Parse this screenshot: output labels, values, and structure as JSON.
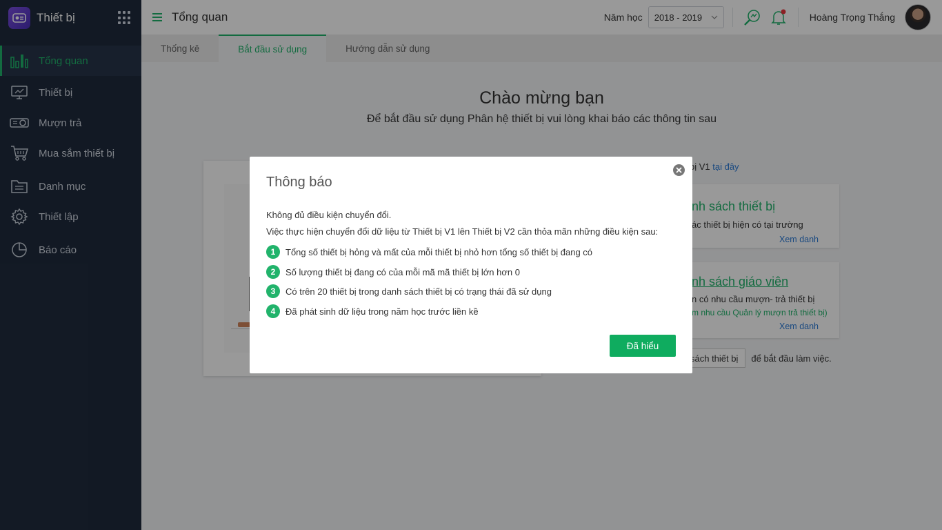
{
  "app": {
    "title": "Thiết bị"
  },
  "sidebar": {
    "items": [
      {
        "label": "Tổng quan",
        "icon": "bar-chart-icon",
        "active": true
      },
      {
        "label": "Thiết bị",
        "icon": "monitor-icon"
      },
      {
        "label": "Mượn trả",
        "icon": "projector-icon"
      },
      {
        "label": "Mua sắm thiết bị",
        "icon": "cart-icon"
      },
      {
        "label": "Danh mục",
        "icon": "folder-list-icon"
      },
      {
        "label": "Thiết lập",
        "icon": "gear-icon"
      },
      {
        "label": "Báo cáo",
        "icon": "pie-chart-icon"
      }
    ]
  },
  "header": {
    "title": "Tổng quan",
    "year_label": "Năm học",
    "year_value": "2018 - 2019",
    "user_name": "Hoàng Trọng  Thắng"
  },
  "tabs": [
    {
      "label": "Thống kê"
    },
    {
      "label": "Bắt đầu sử dụng",
      "active": true
    },
    {
      "label": "Hướng dẫn sử dụng"
    }
  ],
  "main": {
    "welcome_title": "Chào mừng bạn",
    "welcome_subtitle": "Để bắt đầu sử dụng Phân hệ thiết bị vui lòng khai báo các thông tin sau",
    "v1_note": "bị V1 ",
    "v1_link": "tại đây",
    "card1": {
      "title": "nh sách thiết bị",
      "desc": "ác thiết bị hiện có tại trường",
      "link": "Xem danh"
    },
    "card2": {
      "title": "nh sách giáo viên",
      "desc": "n có nhu cầu mượn- trả thiết bị",
      "note": "m nhu cầu Quản lý mượn trả thiết bị)",
      "link": "Xem danh"
    },
    "bottom_button": "sách thiết bị",
    "bottom_text": "để bắt đầu làm việc."
  },
  "modal": {
    "title": "Thông báo",
    "line1": "Không đủ điều kiện chuyển đổi.",
    "line2": "Việc thực hiện chuyển đổi dữ liệu từ Thiết bị V1 lên Thiết bị V2 cần thỏa mãn những điều kiện sau:",
    "conditions": [
      {
        "num": "1",
        "text": "Tổng số thiết bị hỏng và mất của mỗi thiết bị nhỏ hơn tổng số thiết bị đang có"
      },
      {
        "num": "2",
        "text": "Số lượng thiết bị đang có của mỗi mã mã thiết bị lớn hơn 0"
      },
      {
        "num": "3",
        "text": "Có trên 20 thiết bị trong danh sách thiết bị có trạng thái đã sử dụng"
      },
      {
        "num": "4",
        "text": "Đã phát sinh dữ liệu trong năm học trước liền kề"
      }
    ],
    "ok_button": "Đã hiểu"
  },
  "colors": {
    "accent": "#21b36b",
    "sidebar_bg": "#1f2b3d",
    "link": "#2b7ad6"
  }
}
